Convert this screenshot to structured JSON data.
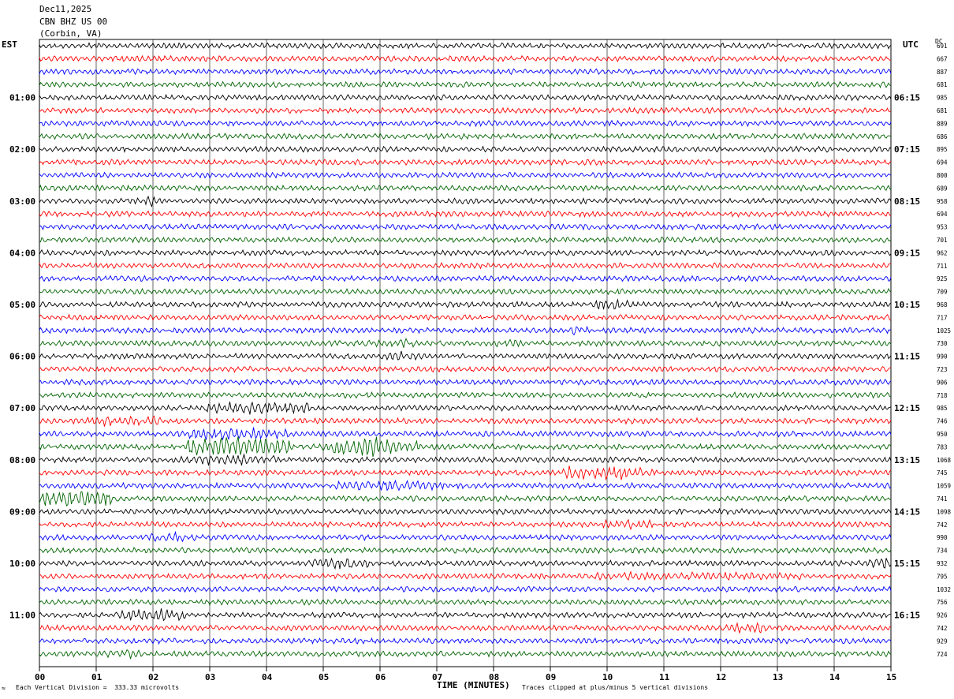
{
  "header": {
    "date": "Dec11,2025",
    "station": "CBN BHZ US 00",
    "location": "(Corbin, VA)"
  },
  "left_tz": "EST",
  "right_tz": "UTC",
  "dc_label": "DC",
  "footer": {
    "division_note": "Each Vertical Division =  333.33 microvolts",
    "clip_note": "Traces clipped at plus/minus 5 vertical divisions",
    "corner_mark": "≈"
  },
  "chart_data": {
    "type": "line",
    "title": "",
    "xlabel": "TIME (MINUTES)",
    "ylabel": "",
    "x_ticks": [
      "00",
      "01",
      "02",
      "03",
      "04",
      "05",
      "06",
      "07",
      "08",
      "09",
      "10",
      "11",
      "12",
      "13",
      "14",
      "15"
    ],
    "xlim": [
      0,
      15
    ],
    "grid": true,
    "trace_colors": [
      "#000000",
      "#ff0000",
      "#0000ff",
      "#006400"
    ],
    "left_time_labels": [
      "01:00",
      "02:00",
      "03:00",
      "04:00",
      "05:00",
      "06:00",
      "07:00",
      "08:00",
      "09:00",
      "10:00",
      "11:00"
    ],
    "right_time_labels": [
      "06:15",
      "07:15",
      "08:15",
      "09:15",
      "10:15",
      "11:15",
      "12:15",
      "13:15",
      "14:15",
      "15:15",
      "16:15"
    ],
    "dc_offsets": [
      "691",
      "667",
      "887",
      "681",
      "985",
      "681",
      "889",
      "686",
      "895",
      "694",
      "800",
      "689",
      "958",
      "694",
      "953",
      "701",
      "962",
      "711",
      "925",
      "709",
      "968",
      "717",
      "1025",
      "730",
      "990",
      "723",
      "906",
      "718",
      "985",
      "746",
      "950",
      "783",
      "1068",
      "745",
      "1059",
      "741",
      "1098",
      "742",
      "990",
      "734",
      "932",
      "795",
      "1032",
      "756",
      "926",
      "742",
      "929",
      "724"
    ],
    "bursts": [
      {
        "trace": 28,
        "start": 2.9,
        "end": 4.8,
        "level": 2.2
      },
      {
        "trace": 29,
        "start": 0.8,
        "end": 2.2,
        "level": 1.7
      },
      {
        "trace": 30,
        "start": 2.4,
        "end": 4.4,
        "level": 2.0
      },
      {
        "trace": 31,
        "start": 2.6,
        "end": 4.4,
        "level": 3.6
      },
      {
        "trace": 31,
        "start": 5.0,
        "end": 6.7,
        "level": 3.3
      },
      {
        "trace": 32,
        "start": 2.5,
        "end": 4.2,
        "level": 1.8
      },
      {
        "trace": 33,
        "start": 9.2,
        "end": 10.8,
        "level": 2.6
      },
      {
        "trace": 34,
        "start": 5.2,
        "end": 7.2,
        "level": 1.7
      },
      {
        "trace": 35,
        "start": 0.0,
        "end": 1.3,
        "level": 3.2
      },
      {
        "trace": 37,
        "start": 9.8,
        "end": 10.9,
        "level": 1.6
      },
      {
        "trace": 38,
        "start": 1.9,
        "end": 2.8,
        "level": 1.7
      },
      {
        "trace": 40,
        "start": 4.8,
        "end": 5.8,
        "level": 2.0
      },
      {
        "trace": 40,
        "start": 14.6,
        "end": 15.0,
        "level": 2.2
      },
      {
        "trace": 41,
        "start": 9.0,
        "end": 13.5,
        "level": 1.4
      },
      {
        "trace": 44,
        "start": 1.3,
        "end": 2.6,
        "level": 2.1
      },
      {
        "trace": 45,
        "start": 12.0,
        "end": 12.8,
        "level": 1.8
      },
      {
        "trace": 47,
        "start": 1.1,
        "end": 1.9,
        "level": 1.6
      },
      {
        "trace": 20,
        "start": 9.8,
        "end": 10.4,
        "level": 1.8
      },
      {
        "trace": 22,
        "start": 9.3,
        "end": 9.7,
        "level": 1.6
      },
      {
        "trace": 23,
        "start": 5.8,
        "end": 6.6,
        "level": 1.6
      },
      {
        "trace": 23,
        "start": 7.9,
        "end": 8.6,
        "level": 1.6
      },
      {
        "trace": 24,
        "start": 6.0,
        "end": 6.8,
        "level": 1.5
      },
      {
        "trace": 12,
        "start": 1.7,
        "end": 2.1,
        "level": 1.6
      }
    ]
  }
}
